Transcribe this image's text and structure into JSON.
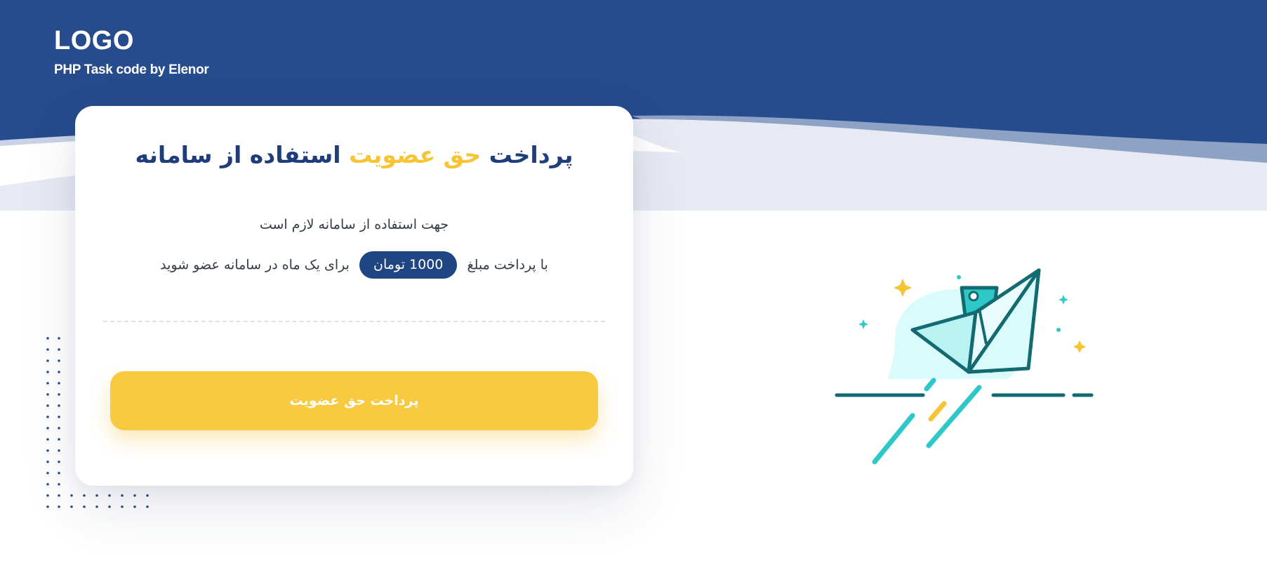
{
  "header": {
    "logo": "LOGO",
    "tagline": "PHP Task code by Elenor"
  },
  "card": {
    "title_part1": "پرداخت ",
    "title_highlight": "حق عضویت",
    "title_part2": " استفاده از سامانه",
    "line1": "جهت استفاده از سامانه لازم است",
    "line2_before": "با پرداخت مبلغ",
    "price": "1000 تومان",
    "line2_after": "برای یک ماه در سامانه عضو شوید",
    "pay_button_label": "پرداخت حق عضویت"
  },
  "colors": {
    "primary": "#1f4583",
    "accent": "#f7ca3f",
    "teal": "#2ec8c8"
  },
  "illustration": {
    "icon": "paper-plane-icon"
  }
}
